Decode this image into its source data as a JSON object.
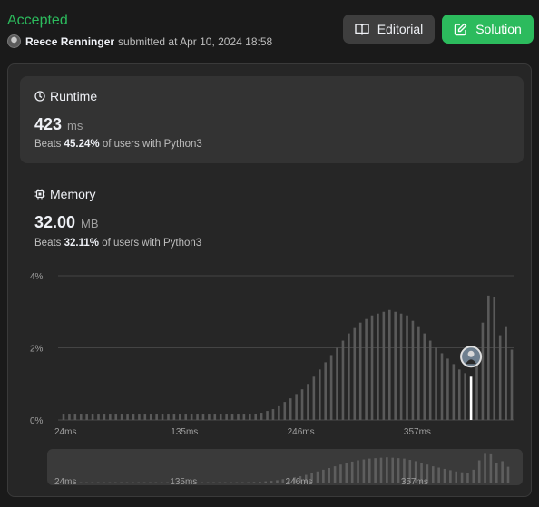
{
  "header": {
    "status": "Accepted",
    "user": "Reece Renninger",
    "submitted_text": "submitted at Apr 10, 2024 18:58",
    "editorial_label": "Editorial",
    "solution_label": "Solution"
  },
  "runtime": {
    "title": "Runtime",
    "value": "423",
    "unit": "ms",
    "beats_prefix": "Beats",
    "beats_pct": "45.24%",
    "beats_suffix": "of users with Python3"
  },
  "memory": {
    "title": "Memory",
    "value": "32.00",
    "unit": "MB",
    "beats_prefix": "Beats",
    "beats_pct": "32.11%",
    "beats_suffix": "of users with Python3"
  },
  "colors": {
    "accepted": "#2cbb5d",
    "bar": "#5a5a5a",
    "highlight": "#ffffff"
  },
  "chart_data": {
    "type": "bar",
    "ytick_labels": [
      "4%",
      "2%",
      "0%"
    ],
    "yticks": [
      4,
      2,
      0
    ],
    "ylim": [
      0,
      4
    ],
    "xtick_labels": [
      "24ms",
      "135ms",
      "246ms",
      "357ms"
    ],
    "xtick_positions": [
      24,
      135,
      246,
      357
    ],
    "x_start": 24,
    "x_step": 5.55,
    "values": [
      0.15,
      0.15,
      0.15,
      0.15,
      0.15,
      0.15,
      0.15,
      0.15,
      0.15,
      0.15,
      0.15,
      0.15,
      0.15,
      0.15,
      0.15,
      0.15,
      0.15,
      0.15,
      0.15,
      0.15,
      0.15,
      0.15,
      0.15,
      0.15,
      0.15,
      0.15,
      0.15,
      0.15,
      0.15,
      0.15,
      0.15,
      0.15,
      0.15,
      0.17,
      0.2,
      0.25,
      0.3,
      0.38,
      0.5,
      0.6,
      0.72,
      0.85,
      1.0,
      1.2,
      1.4,
      1.6,
      1.8,
      2.0,
      2.2,
      2.4,
      2.55,
      2.7,
      2.8,
      2.9,
      2.95,
      3.0,
      3.05,
      3.0,
      2.95,
      2.9,
      2.75,
      2.6,
      2.4,
      2.2,
      2.0,
      1.85,
      1.7,
      1.55,
      1.4,
      1.3,
      1.2,
      1.6,
      2.7,
      3.45,
      3.4,
      2.35,
      2.6,
      1.95
    ],
    "highlight_index": 70,
    "highlight_value": 1.2
  }
}
